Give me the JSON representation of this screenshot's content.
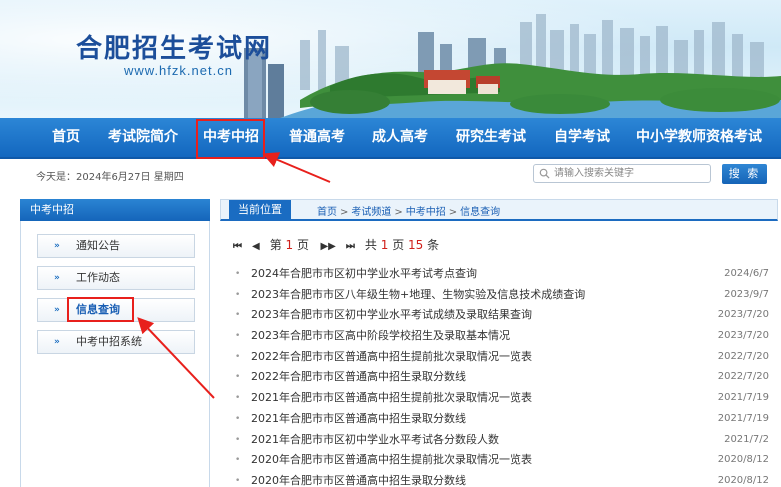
{
  "site": {
    "title": "合肥招生考试网",
    "url": "www.hfzk.net.cn"
  },
  "nav": {
    "items": [
      {
        "label": "首页"
      },
      {
        "label": "考试院简介"
      },
      {
        "label": "中考中招",
        "highlighted": true
      },
      {
        "label": "普通高考"
      },
      {
        "label": "成人高考"
      },
      {
        "label": "研究生考试"
      },
      {
        "label": "自学考试"
      },
      {
        "label": "中小学教师资格考试"
      }
    ]
  },
  "toolbar": {
    "date_text": "今天是：2024年6月27日 星期四",
    "search_placeholder": "请输入搜索关键字",
    "search_button": "搜 索"
  },
  "sidebar": {
    "heading": "中考中招",
    "items": [
      {
        "label": "通知公告",
        "arrow": "»"
      },
      {
        "label": "工作动态",
        "arrow": "»"
      },
      {
        "label": "信息查询",
        "arrow": "»",
        "active": true
      },
      {
        "label": "中考中招系统",
        "arrow": "»"
      }
    ]
  },
  "main": {
    "position_label": "当前位置",
    "breadcrumb": [
      "首页",
      "考试频道",
      "中考中招",
      "信息查询"
    ],
    "breadcrumb_sep": ">",
    "pager": {
      "first": "⏮",
      "prev": "◀",
      "page_prefix": "第",
      "current_page": "1",
      "page_suffix": "页",
      "next": "▶▶",
      "last": "⏭",
      "total_prefix": "共",
      "total_pages": "1",
      "total_middle": "页",
      "total_items": "15",
      "total_suffix": "条"
    },
    "news": [
      {
        "title": "2024年合肥市市区初中学业水平考试考点查询",
        "date": "2024/6/7"
      },
      {
        "title": "2023年合肥市市区八年级生物+地理、生物实验及信息技术成绩查询",
        "date": "2023/9/7"
      },
      {
        "title": "2023年合肥市市区初中学业水平考试成绩及录取结果查询",
        "date": "2023/7/20"
      },
      {
        "title": "2023年合肥市市区高中阶段学校招生及录取基本情况",
        "date": "2023/7/20"
      },
      {
        "title": "2022年合肥市市区普通高中招生提前批次录取情况一览表",
        "date": "2022/7/20"
      },
      {
        "title": "2022年合肥市市区普通高中招生录取分数线",
        "date": "2022/7/20"
      },
      {
        "title": "2021年合肥市市区普通高中招生提前批次录取情况一览表",
        "date": "2021/7/19"
      },
      {
        "title": "2021年合肥市市区普通高中招生录取分数线",
        "date": "2021/7/19"
      },
      {
        "title": "2021年合肥市市区初中学业水平考试各分数段人数",
        "date": "2021/7/2"
      },
      {
        "title": "2020年合肥市市区普通高中招生提前批次录取情况一览表",
        "date": "2020/8/12"
      },
      {
        "title": "2020年合肥市市区普通高中招生录取分数线",
        "date": "2020/8/12"
      }
    ]
  },
  "colors": {
    "brand_blue": "#1367bf",
    "highlight_red": "#e8201c",
    "page_number_red": "#d0201b"
  }
}
